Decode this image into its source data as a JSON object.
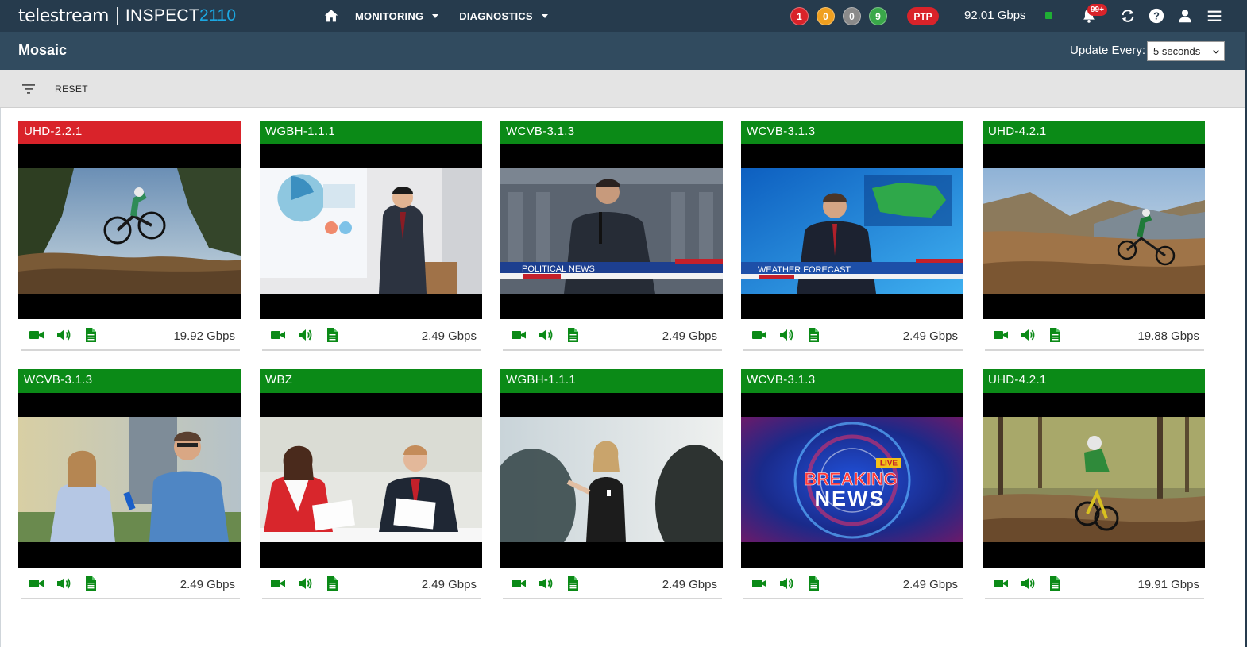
{
  "app": {
    "brand": "telestream",
    "product": "INSPECT",
    "product_number": "2110"
  },
  "nav": {
    "items": [
      {
        "label": "MONITORING"
      },
      {
        "label": "DIAGNOSTICS"
      }
    ]
  },
  "status": {
    "badges": [
      {
        "value": "1",
        "color": "#d9232a"
      },
      {
        "value": "0",
        "color": "#f0a020"
      },
      {
        "value": "0",
        "color": "#8a8a8a"
      },
      {
        "value": "9",
        "color": "#3aa84a"
      }
    ],
    "ptp": "PTP",
    "total_rate": "92.01 Gbps",
    "notifications": "99+"
  },
  "header": {
    "title": "Mosaic",
    "update_label": "Update Every:",
    "update_value": "5 seconds"
  },
  "toolbar": {
    "reset_label": "RESET"
  },
  "tiles": [
    {
      "name": "UHD-2.2.1",
      "status_color": "#d9232a",
      "rate": "19.92 Gbps",
      "scene": "bike-jump"
    },
    {
      "name": "WGBH-1.1.1",
      "status_color": "#0b8a17",
      "rate": "2.49 Gbps",
      "scene": "presenter"
    },
    {
      "name": "WCVB-3.1.3",
      "status_color": "#0b8a17",
      "rate": "2.49 Gbps",
      "scene": "political-news",
      "lower_third": "POLITICAL NEWS"
    },
    {
      "name": "WCVB-3.1.3",
      "status_color": "#0b8a17",
      "rate": "2.49 Gbps",
      "scene": "weather",
      "lower_third": "WEATHER FORECAST"
    },
    {
      "name": "UHD-4.2.1",
      "status_color": "#0b8a17",
      "rate": "19.88 Gbps",
      "scene": "bike-trail"
    },
    {
      "name": "WCVB-3.1.3",
      "status_color": "#0b8a17",
      "rate": "2.49 Gbps",
      "scene": "interview"
    },
    {
      "name": "WBZ",
      "status_color": "#0b8a17",
      "rate": "2.49 Gbps",
      "scene": "anchors"
    },
    {
      "name": "WGBH-1.1.1",
      "status_color": "#0b8a17",
      "rate": "2.49 Gbps",
      "scene": "speaker"
    },
    {
      "name": "WCVB-3.1.3",
      "status_color": "#0b8a17",
      "rate": "2.49 Gbps",
      "scene": "breaking-news",
      "live": "LIVE",
      "headline1": "BREAKING",
      "headline2": "NEWS"
    },
    {
      "name": "UHD-4.2.1",
      "status_color": "#0b8a17",
      "rate": "19.91 Gbps",
      "scene": "bike-forest"
    }
  ],
  "icons": {
    "video": "video-camera-icon",
    "audio": "speaker-icon",
    "document": "document-icon"
  },
  "colors": {
    "topbar": "#263b4d",
    "subheader": "#314b5f",
    "ok": "#0b8a17",
    "error": "#d9232a",
    "accent": "#1ba8e3"
  }
}
